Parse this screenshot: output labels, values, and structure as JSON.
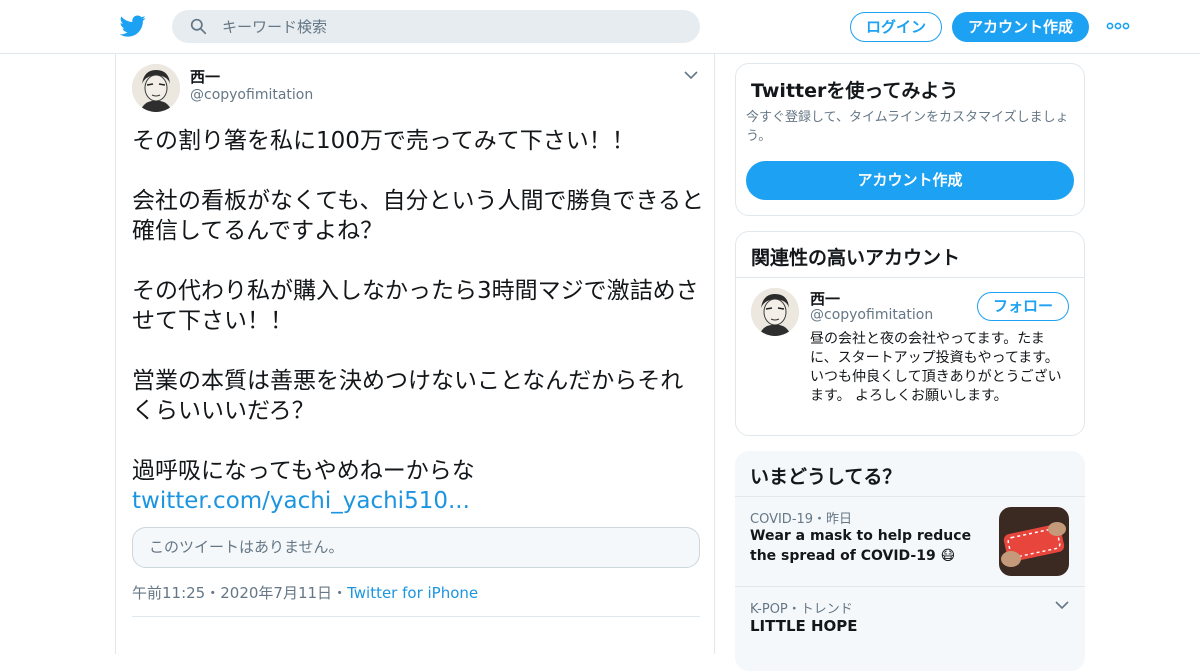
{
  "header": {
    "search_placeholder": "キーワード検索",
    "login_label": "ログイン",
    "signup_label": "アカウント作成",
    "brand_color": "#1da1f2"
  },
  "tweet": {
    "name": "西一",
    "handle": "@copyofimitation",
    "paragraphs": [
      "その割り箸を私に100万で売ってみて下さい！！",
      "会社の看板がなくても、自分という人間で勝負できると確信してるんですよね？",
      "その代わり私が購入しなかったら3時間マジで激詰めさせて下さい！！",
      "営業の本質は善悪を決めつけないことなんだからそれくらいいいだろ？",
      "過呼吸になってもやめねーからな"
    ],
    "link": "twitter.com/yachi_yachi510...",
    "quote_unavailable": "このツイートはありません。",
    "time": "午前11:25",
    "date": "2020年7月11日",
    "source": "Twitter for iPhone"
  },
  "try_panel": {
    "title": "Twitterを使ってみよう",
    "desc": "今すぐ登録して、タイムラインをカスタマイズしましょう。",
    "button": "アカウント作成"
  },
  "related": {
    "title": "関連性の高いアカウント",
    "name": "西一",
    "handle": "@copyofimitation",
    "follow": "フォロー",
    "bio": "昼の会社と夜の会社やってます。たまに、スタートアップ投資もやってます。いつも仲良くして頂きありがとうございます。 よろしくお願いします。"
  },
  "trends": {
    "title": "いまどうしてる？",
    "items": [
      {
        "meta": "COVID-19・昨日",
        "headline": "Wear a mask to help reduce the spread of COVID-19 😷"
      },
      {
        "meta": "K-POP・トレンド",
        "headline": "LITTLE HOPE"
      }
    ]
  }
}
